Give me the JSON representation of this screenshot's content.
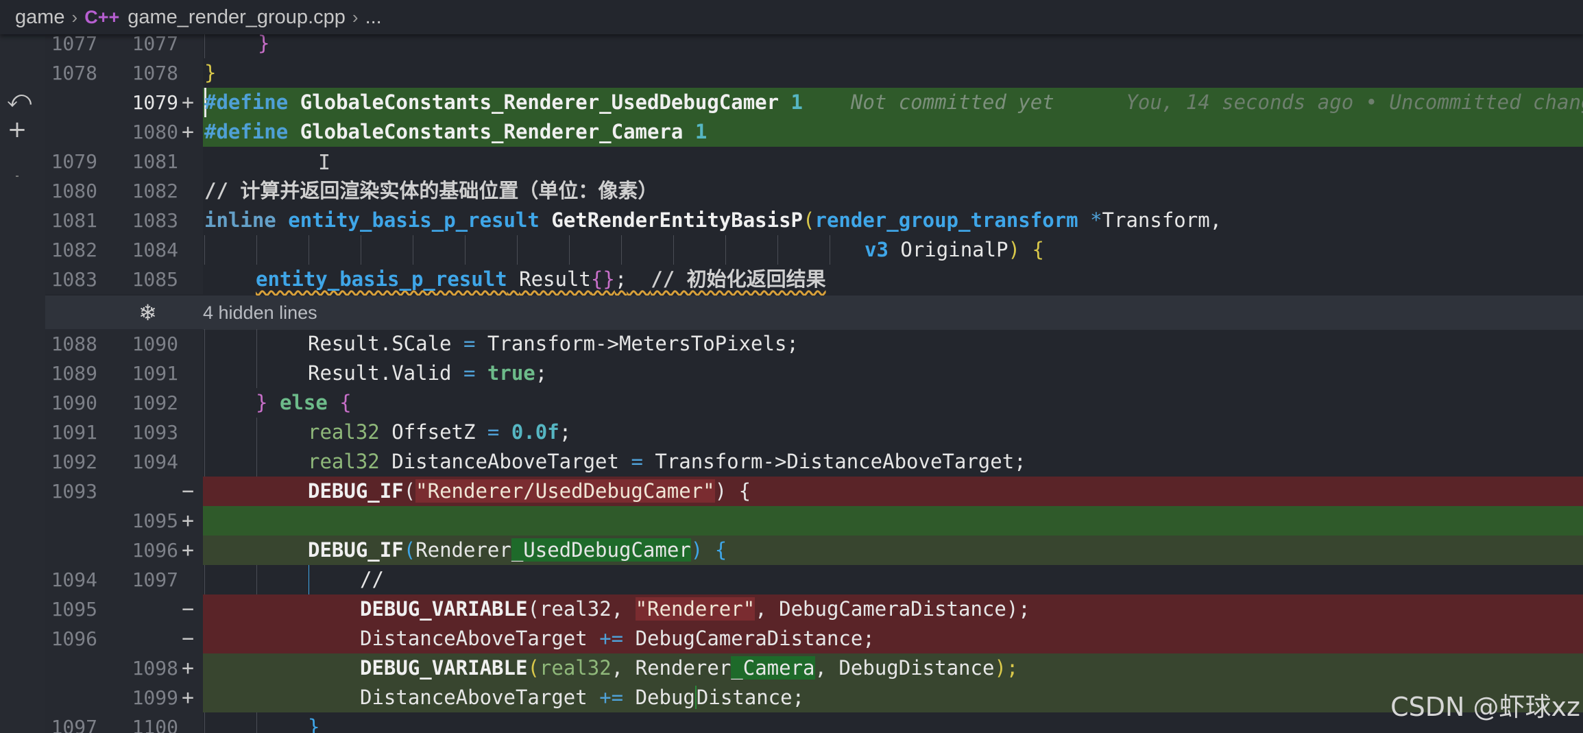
{
  "breadcrumb": {
    "folder": "game",
    "lang_icon": "C++",
    "file": "game_render_group.cpp",
    "more": "..."
  },
  "left_strip": {
    "icons": [
      "undo-arrow-icon",
      "plus-icon"
    ]
  },
  "gutter": {
    "rows": [
      {
        "old": "1077",
        "new": "1077",
        "mark": ""
      },
      {
        "old": "1078",
        "new": "1078",
        "mark": ""
      },
      {
        "old": "",
        "new": "1079",
        "mark": "+"
      },
      {
        "old": "",
        "new": "1080",
        "mark": "+"
      },
      {
        "old": "1079",
        "new": "1081",
        "mark": ""
      },
      {
        "old": "1080",
        "new": "1082",
        "mark": ""
      },
      {
        "old": "1081",
        "new": "1083",
        "mark": ""
      },
      {
        "old": "1082",
        "new": "1084",
        "mark": ""
      },
      {
        "old": "1083",
        "new": "1085",
        "mark": ""
      },
      {
        "old": "1088",
        "new": "1090",
        "mark": ""
      },
      {
        "old": "1089",
        "new": "1091",
        "mark": ""
      },
      {
        "old": "1090",
        "new": "1092",
        "mark": ""
      },
      {
        "old": "1091",
        "new": "1093",
        "mark": ""
      },
      {
        "old": "1092",
        "new": "1094",
        "mark": ""
      },
      {
        "old": "1093",
        "new": "",
        "mark": "−"
      },
      {
        "old": "",
        "new": "1095",
        "mark": "+"
      },
      {
        "old": "",
        "new": "1096",
        "mark": "+"
      },
      {
        "old": "1094",
        "new": "1097",
        "mark": ""
      },
      {
        "old": "1095",
        "new": "",
        "mark": "−"
      },
      {
        "old": "1096",
        "new": "",
        "mark": "−"
      },
      {
        "old": "",
        "new": "1098",
        "mark": "+"
      },
      {
        "old": "",
        "new": "1099",
        "mark": "+"
      },
      {
        "old": "1097",
        "new": "1100",
        "mark": ""
      }
    ]
  },
  "code": {
    "l1077": "}",
    "l1078": "}",
    "l1079": {
      "directive": "#define",
      "name": "GlobaleConstants_Renderer_UsedDebugCamer",
      "value": "1",
      "blame": "Not committed yet",
      "blame2": "You, 14 seconds ago • Uncommitted changes"
    },
    "l1080": {
      "directive": "#define",
      "name": "GlobaleConstants_Renderer_Camera",
      "value": "1"
    },
    "l1082": "// 计算并返回渲染实体的基础位置（单位：像素）",
    "l1083": {
      "kw": "inline",
      "type": "entity_basis_p_result",
      "fn": "GetRenderEntityBasisP",
      "open": "(",
      "ptype": "render_group_transform",
      "star": "*",
      "pname": "Transform,"
    },
    "l1084": {
      "type": "v3",
      "pname": "OriginalP",
      "close": ")",
      "brace": "{"
    },
    "l1085": {
      "type": "entity_basis_p_result",
      "var": "Result",
      "init": "{}",
      "semi": ";",
      "comment": "// 初始化返回结果"
    },
    "hidden": "4 hidden lines",
    "l1090": {
      "lhs": "Result.SCale",
      "eq": "=",
      "rhs": "Transform->MetersToPixels;"
    },
    "l1091": {
      "lhs": "Result.Valid",
      "eq": "=",
      "rhs": "true",
      "semi": ";"
    },
    "l1092": {
      "close": "}",
      "kw": "else",
      "open": "{"
    },
    "l1093": {
      "type": "real32",
      "name": "OffsetZ",
      "eq": "=",
      "num": "0.0f",
      "semi": ";"
    },
    "l1094": {
      "type": "real32",
      "name": "DistanceAboveTarget",
      "eq": "=",
      "rhs": "Transform->DistanceAboveTarget;"
    },
    "r1093": {
      "fn": "DEBUG_IF",
      "open": "(",
      "str": "\"Renderer/UsedDebugCamer\"",
      "close": ")",
      "brace": "{"
    },
    "l1096": {
      "fn": "DEBUG_IF",
      "open": "(",
      "a": "Renderer",
      "b": "_UsedDebugCamer",
      "close": ")",
      "brace": "{"
    },
    "l1097": "//",
    "r1095": {
      "fn": "DEBUG_VARIABLE",
      "open": "(real32, ",
      "str": "\"Renderer\"",
      "rest": ", DebugCameraDistance);"
    },
    "r1096": {
      "a": "DistanceAboveTarget",
      "op": "+=",
      "b": "DebugCameraDistance;"
    },
    "l1098": {
      "fn": "DEBUG_VARIABLE",
      "open": "(",
      "type": "real32",
      "c1": ",",
      "a": "Renderer",
      "b": "_Camera",
      "c2": ",",
      "d": "DebugDistance",
      "close": ");"
    },
    "l1099": {
      "a": "DistanceAboveTarget",
      "op": "+=",
      "b": "Debug",
      "c": "Distance;"
    },
    "l1100": "}"
  },
  "watermark": "CSDN @虾球xz"
}
